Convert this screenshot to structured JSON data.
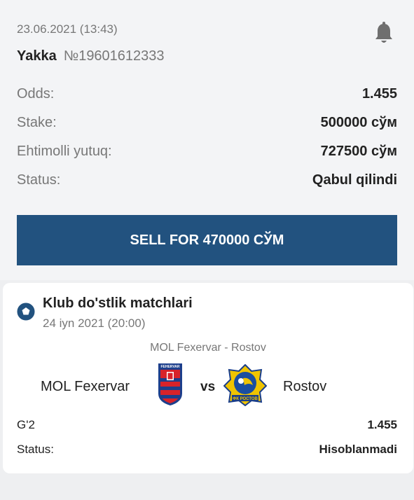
{
  "bet": {
    "datetime": "23.06.2021 (13:43)",
    "type": "Yakka",
    "number": "№19601612333",
    "details": [
      {
        "label": "Odds:",
        "value": "1.455"
      },
      {
        "label": "Stake:",
        "value": "500000 сўм"
      },
      {
        "label": "Ehtimolli yutuq:",
        "value": "727500 сўм"
      },
      {
        "label": "Status:",
        "value": "Qabul qilindi"
      }
    ],
    "sell_label": "SELL FOR 470000 СЎМ"
  },
  "icons": {
    "notification": "bell-icon",
    "sport": "football-icon"
  },
  "event": {
    "league": "Klub do'stlik matchlari",
    "date": "24 iyn 2021 (20:00)",
    "match_name": "MOL Fexervar - Rostov",
    "home_team": "MOL Fexervar",
    "vs": "vs",
    "away_team": "Rostov",
    "outcome_label": "G'2",
    "outcome_odds": "1.455",
    "status_label": "Status:",
    "status_value": "Hisoblanmadi",
    "home_logo_text": "FEHERVAR",
    "away_logo_text": "ФК РОСТОВ"
  },
  "colors": {
    "accent": "#22527f",
    "background": "#f3f4f6",
    "card": "#ffffff"
  }
}
